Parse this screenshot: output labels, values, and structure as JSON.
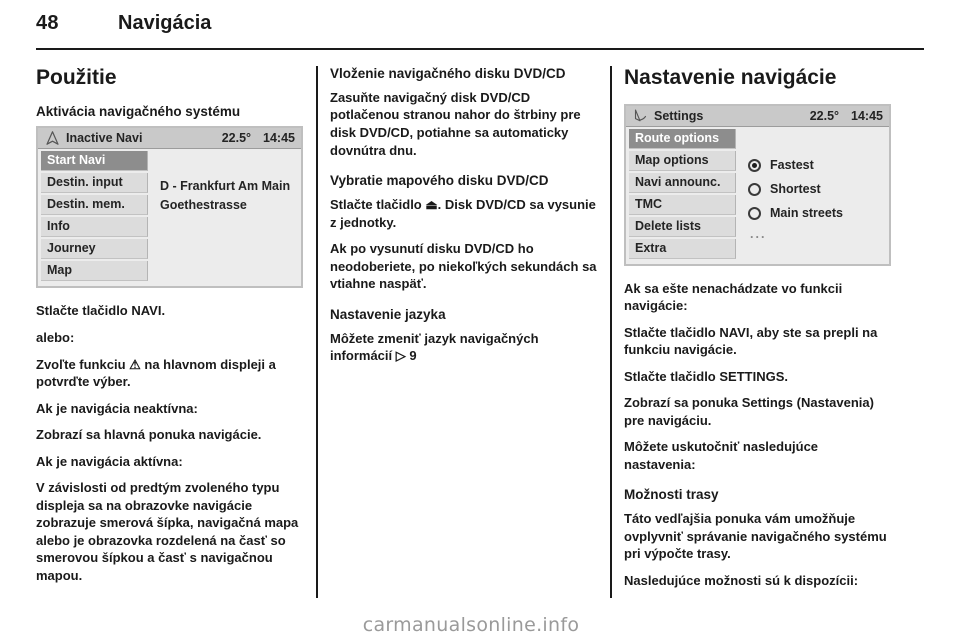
{
  "page": {
    "number": "48",
    "chapter": "Navigácia",
    "footer_watermark": "carmanualsonline.info"
  },
  "column_left": {
    "section_title": "Použitie",
    "subsection_title": "Aktivácia navigačného systému",
    "screen": {
      "status_icon": "navigation-arrow-icon",
      "title": "Inactive Navi",
      "temperature": "22.5°",
      "time": "14:45",
      "menu_items": [
        {
          "label": "Start Navi",
          "selected": true
        },
        {
          "label": "Destin. input",
          "selected": false
        },
        {
          "label": "Destin. mem.",
          "selected": false
        },
        {
          "label": "Info",
          "selected": false
        },
        {
          "label": "Journey",
          "selected": false
        },
        {
          "label": "Map",
          "selected": false
        }
      ],
      "detail_lines": [
        "D - Frankfurt Am Main",
        "Goethestrasse"
      ]
    },
    "paragraphs": [
      "Stlačte tlačidlo NAVI.",
      "alebo:",
      "Zvoľte funkciu ⚠ na hlavnom displeji a potvrďte výber.",
      "Ak je navigácia neaktívna:",
      "Zobrazí sa hlavná ponuka navigácie.",
      "Ak je navigácia aktívna:",
      "V závislosti od predtým zvoleného typu displeja sa na obrazovke navigácie zobrazuje smerová šípka, navigačná mapa alebo je obrazovka rozdelená na časť so smerovou šípkou a časť s navigačnou mapou."
    ]
  },
  "column_middle": {
    "heading_1": "Vloženie navigačného disku DVD/CD",
    "paragraph_1": "Zasuňte navigačný disk DVD/CD potlačenou stranou nahor do štrbiny pre disk DVD/CD, potiahne sa automaticky dovnútra dnu.",
    "heading_2": "Vybratie mapového disku DVD/CD",
    "paragraph_2": "Stlačte tlačidlo ⏏. Disk DVD/CD sa vysunie z jednotky.",
    "paragraph_3": "Ak po vysunutí disku DVD/CD ho neodoberiete, po niekoľkých sekundách sa vtiahne naspäť.",
    "heading_3": "Nastavenie jazyka",
    "paragraph_4": "Môžete zmeniť jazyk navigačných informácií ▷ 9"
  },
  "column_right": {
    "section_title": "Nastavenie navigácie",
    "screen": {
      "status_icon": "navigation-settings-icon",
      "title": "Settings",
      "temperature": "22.5°",
      "time": "14:45",
      "menu_items": [
        {
          "label": "Route options",
          "selected": true
        },
        {
          "label": "Map options",
          "selected": false
        },
        {
          "label": "Navi announc.",
          "selected": false
        },
        {
          "label": "TMC",
          "selected": false
        },
        {
          "label": "Delete lists",
          "selected": false
        },
        {
          "label": "Extra",
          "selected": false
        }
      ],
      "radio_options": [
        {
          "label": "Fastest",
          "selected": true
        },
        {
          "label": "Shortest",
          "selected": false
        },
        {
          "label": "Main streets",
          "selected": false
        }
      ],
      "more_indicator": "..."
    },
    "paragraphs": [
      "Ak sa ešte nenachádzate vo funkcii navigácie:",
      "Stlačte tlačidlo NAVI, aby ste sa prepli na funkciu navigácie.",
      "Stlačte tlačidlo SETTINGS.",
      "Zobrazí sa ponuka Settings (Nastavenia) pre navigáciu.",
      "Môžete uskutočniť nasledujúce nastavenia:"
    ],
    "subsection_title": "Možnosti trasy",
    "paragraph_after_sub_1": "Táto vedľajšia ponuka vám umožňuje ovplyvniť správanie navigačného systému pri výpočte trasy.",
    "paragraph_after_sub_2": "Nasledujúce možnosti sú k dispozícii:"
  }
}
